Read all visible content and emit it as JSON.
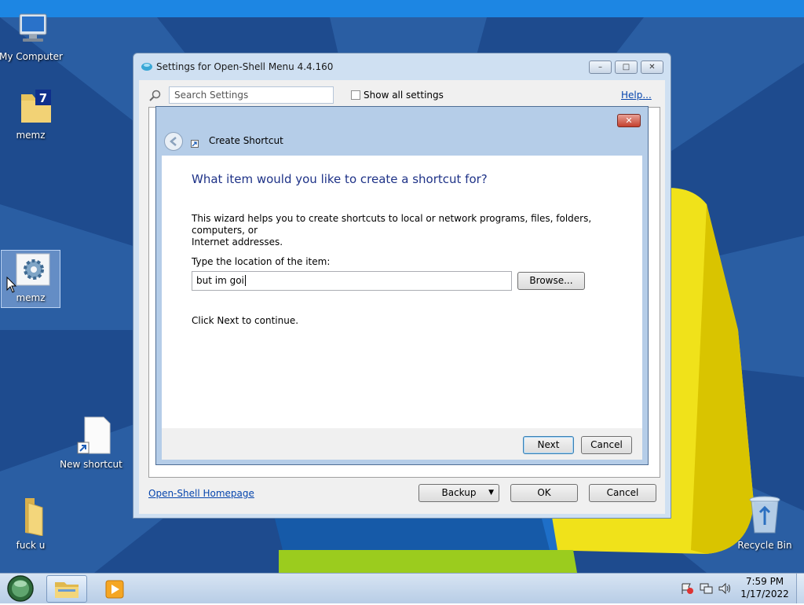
{
  "desktop": {
    "icons": [
      {
        "label": "My Computer",
        "icon": "computer-icon"
      },
      {
        "label": "memz",
        "icon": "7zip-archive-icon"
      },
      {
        "label": "memz",
        "icon": "gear-settings-icon"
      },
      {
        "label": "New shortcut",
        "icon": "shortcut-file-icon"
      },
      {
        "label": "fuck u",
        "icon": "folder-icon"
      },
      {
        "label": "Recycle Bin",
        "icon": "recycle-bin-icon"
      }
    ]
  },
  "settings_window": {
    "title": "Settings for Open-Shell Menu 4.4.160",
    "search_placeholder": "Search Settings",
    "show_all_label": "Show all settings",
    "help_link": "Help...",
    "homepage_link": "Open-Shell Homepage",
    "backup_button": "Backup",
    "ok_button": "OK",
    "cancel_button": "Cancel"
  },
  "wizard": {
    "title": "Create Shortcut",
    "heading": "What item would you like to create a shortcut for?",
    "description_line1": "This wizard helps you to create shortcuts to local or network programs, files, folders, computers, or",
    "description_line2": "Internet addresses.",
    "location_label": "Type the location of the item:",
    "location_value": "but im goi",
    "browse_button": "Browse...",
    "continue_text": "Click Next to continue.",
    "next_button": "Next",
    "cancel_button": "Cancel"
  },
  "taskbar": {
    "time": "7:59 PM",
    "date": "1/17/2022"
  },
  "colors": {
    "accent_blue": "#1e3287",
    "link": "#0645ad",
    "desktop_blue": "#1e4b8e"
  }
}
